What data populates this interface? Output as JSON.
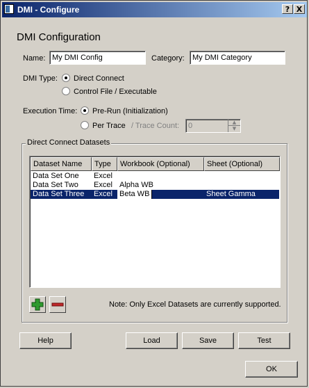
{
  "window": {
    "title": "DMI - Configure",
    "help_label": "?",
    "close_label": "X"
  },
  "heading": "DMI Configuration",
  "name": {
    "label": "Name:",
    "value": "My DMI Config"
  },
  "category": {
    "label": "Category:",
    "value": "My DMI Category"
  },
  "dmi_type": {
    "label": "DMI Type:",
    "options": [
      "Direct Connect",
      "Control File / Executable"
    ],
    "selected": "Direct Connect"
  },
  "execution_time": {
    "label": "Execution Time:",
    "options": [
      "Pre-Run (Initialization)",
      "Per Trace"
    ],
    "selected": "Pre-Run (Initialization)",
    "trace_count_label": "/ Trace Count:",
    "trace_count_value": "0"
  },
  "datasets": {
    "group_title": "Direct Connect Datasets",
    "columns": [
      "Dataset Name",
      "Type",
      "Workbook (Optional)",
      "Sheet (Optional)"
    ],
    "rows": [
      {
        "name": "Data Set One",
        "type": "Excel",
        "workbook": "",
        "sheet": ""
      },
      {
        "name": "Data Set Two",
        "type": "Excel",
        "workbook": "Alpha WB",
        "sheet": ""
      },
      {
        "name": "Data Set Three",
        "type": "Excel",
        "workbook": "Beta WB",
        "sheet": "Sheet Gamma"
      }
    ],
    "selected_row": 2,
    "note": "Note: Only Excel Datasets are currently supported."
  },
  "buttons": {
    "help": "Help",
    "load": "Load",
    "save": "Save",
    "test": "Test",
    "ok": "OK"
  },
  "colors": {
    "title_bar": "#0a246a",
    "selection": "#0a246a",
    "add_icon": "#2e9a2e",
    "remove_icon": "#c0282a"
  }
}
